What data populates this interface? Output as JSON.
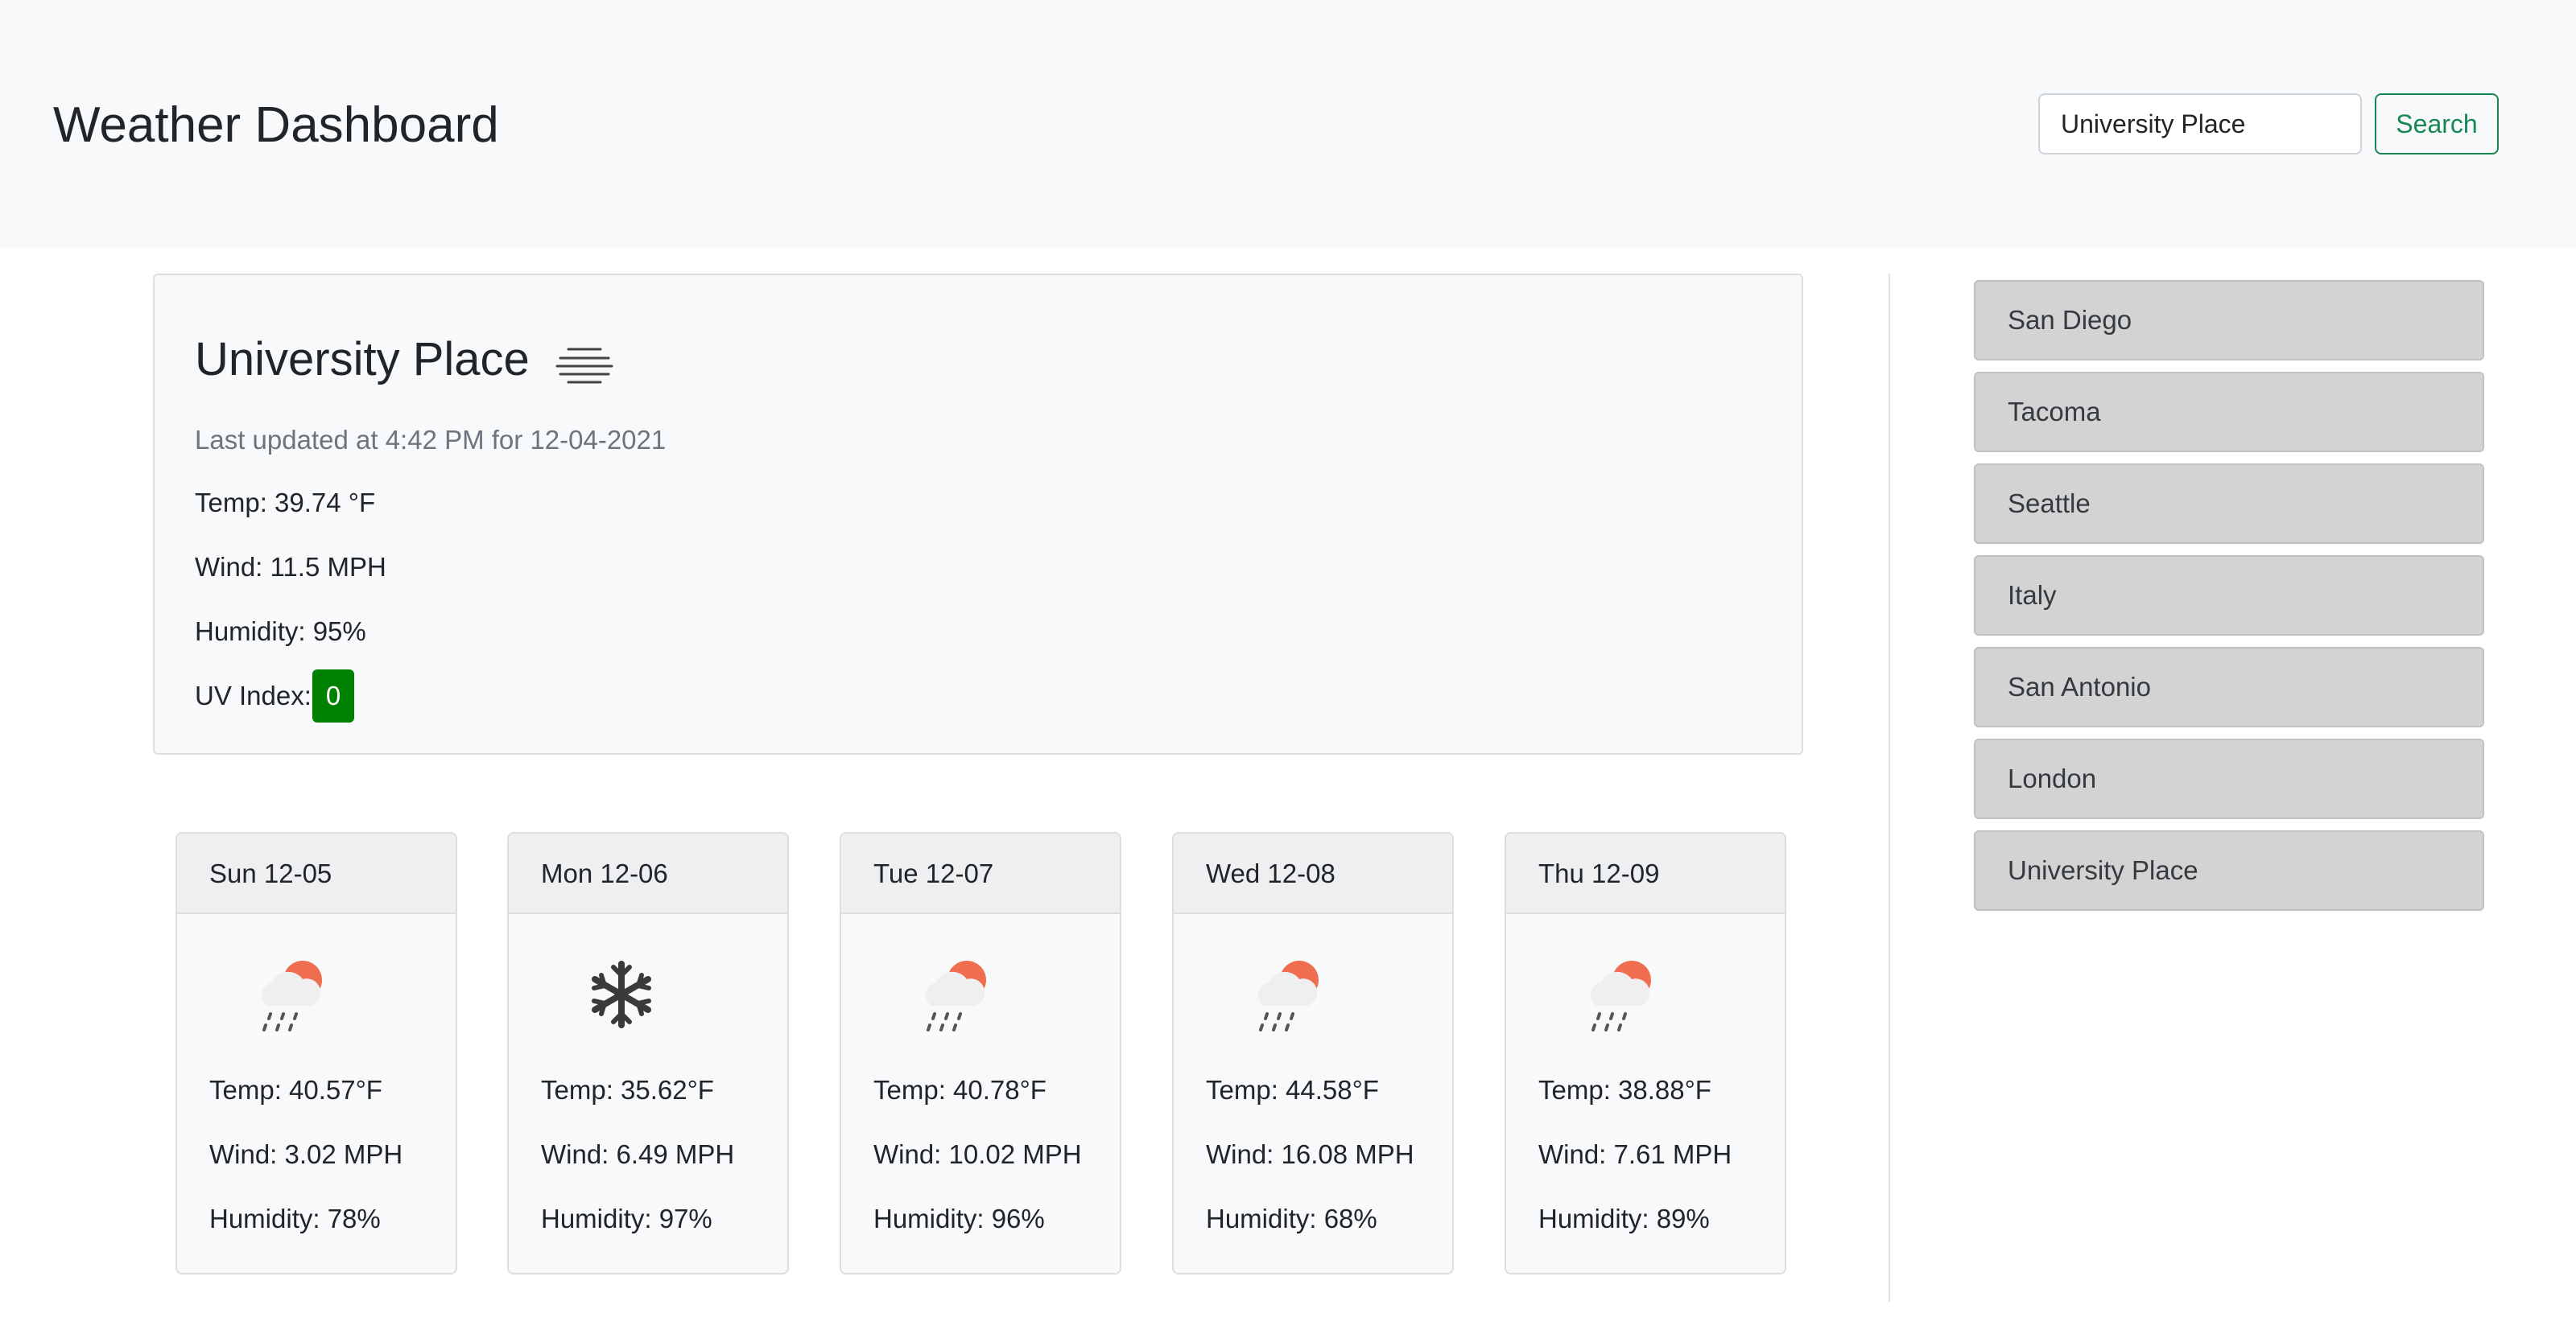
{
  "header": {
    "title": "Weather Dashboard",
    "search_value": "University Place",
    "search_button": "Search"
  },
  "current": {
    "city": "University Place",
    "icon": "mist-icon",
    "updated": "Last updated at 4:42 PM for 12-04-2021",
    "temp": "Temp: 39.74 °F",
    "wind": "Wind: 11.5 MPH",
    "humidity": "Humidity: 95%",
    "uv_label": "UV Index:",
    "uv_value": "0",
    "uv_color": "#008000"
  },
  "history": [
    "San Diego",
    "Tacoma",
    "Seattle",
    "Italy",
    "San Antonio",
    "London",
    "University Place"
  ],
  "forecast": [
    {
      "day": "Sun 12-05",
      "icon": "rain-sun-icon",
      "temp": "Temp: 40.57°F",
      "wind": "Wind: 3.02 MPH",
      "humidity": "Humidity: 78%"
    },
    {
      "day": "Mon 12-06",
      "icon": "snowflake-icon",
      "temp": "Temp: 35.62°F",
      "wind": "Wind: 6.49 MPH",
      "humidity": "Humidity: 97%"
    },
    {
      "day": "Tue 12-07",
      "icon": "rain-sun-icon",
      "temp": "Temp: 40.78°F",
      "wind": "Wind: 10.02 MPH",
      "humidity": "Humidity: 96%"
    },
    {
      "day": "Wed 12-08",
      "icon": "rain-sun-icon",
      "temp": "Temp: 44.58°F",
      "wind": "Wind: 16.08 MPH",
      "humidity": "Humidity: 68%"
    },
    {
      "day": "Thu 12-09",
      "icon": "rain-sun-icon",
      "temp": "Temp: 38.88°F",
      "wind": "Wind: 7.61 MPH",
      "humidity": "Humidity: 89%"
    }
  ]
}
